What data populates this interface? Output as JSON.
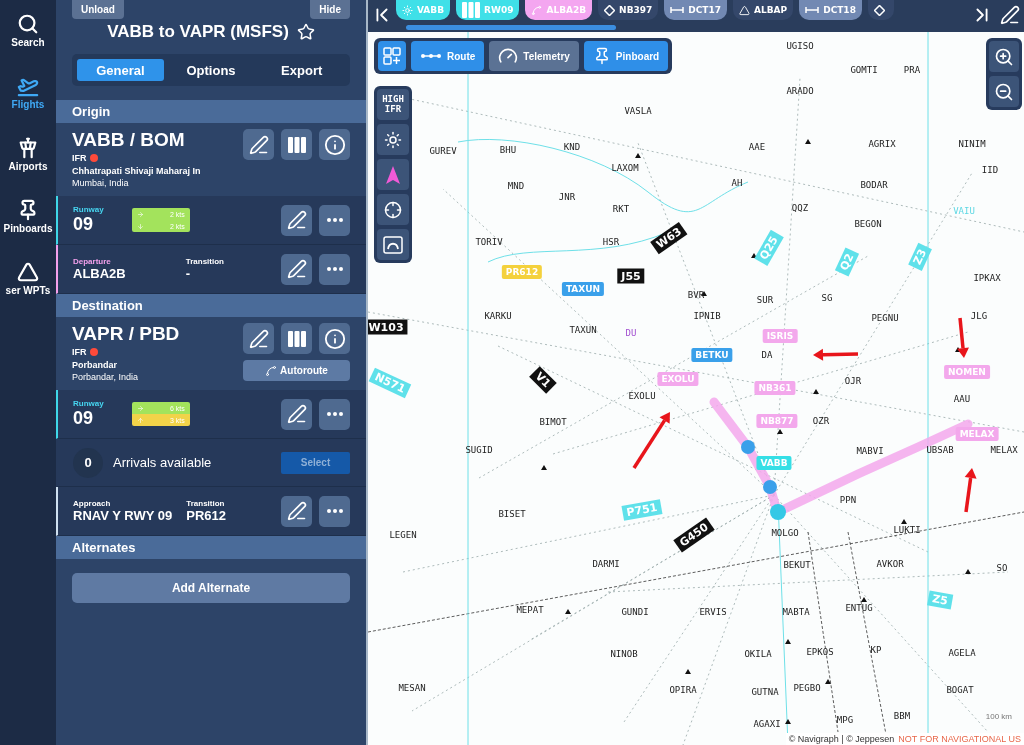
{
  "nav": [
    {
      "label": "Search",
      "selected": false
    },
    {
      "label": "Flights",
      "selected": true
    },
    {
      "label": "Airports",
      "selected": false
    },
    {
      "label": "Pinboards",
      "selected": false
    },
    {
      "label": "ser WPTs",
      "selected": false
    }
  ],
  "flight": {
    "unload": "Unload",
    "hide": "Hide",
    "title": "VABB to VAPR (MSFS)",
    "favorite": false,
    "tabs": [
      {
        "label": "General",
        "selected": true
      },
      {
        "label": "Options",
        "selected": false
      },
      {
        "label": "Export",
        "selected": false
      }
    ]
  },
  "origin": {
    "heading": "Origin",
    "code": "VABB / BOM",
    "rules": "IFR",
    "name": "Chhatrapati Shivaji Maharaj In",
    "city": "Mumbai, India",
    "runway": {
      "label": "Runway",
      "value": "09",
      "wind": [
        {
          "text": "2 kts",
          "kind": "crosswind",
          "color": "#a3e35c"
        },
        {
          "text": "2 kts",
          "kind": "tailwind",
          "color": "#a3e35c"
        }
      ]
    },
    "departure": {
      "label": "Departure",
      "value": "ALBA2B",
      "transition_label": "Transition",
      "transition": "-"
    }
  },
  "destination": {
    "heading": "Destination",
    "code": "VAPR / PBD",
    "rules": "IFR",
    "name": "Porbandar",
    "city": "Porbandar, India",
    "autoroute": "Autoroute",
    "runway": {
      "label": "Runway",
      "value": "09",
      "wind": [
        {
          "text": "6 kts",
          "kind": "crosswind",
          "color": "#a3e35c"
        },
        {
          "text": "3 kts",
          "kind": "headwind",
          "color": "#f2d349"
        }
      ]
    },
    "arrivals": {
      "count": "0",
      "label": "Arrivals available",
      "button": "Select"
    },
    "approach": {
      "label": "Approach",
      "value": "RNAV Y RWY 09",
      "transition_label": "Transition",
      "transition": "PR612"
    }
  },
  "alternates": {
    "heading": "Alternates",
    "button": "Add Alternate"
  },
  "route_bar": {
    "chips": [
      {
        "label": "VABB",
        "kind": "airport"
      },
      {
        "label": "RW09",
        "kind": "runway"
      },
      {
        "label": "ALBA2B",
        "kind": "procedure"
      },
      {
        "label": "NB397",
        "kind": "fix"
      },
      {
        "label": "DCT17",
        "kind": "direct"
      },
      {
        "label": "ALBAP",
        "kind": "user"
      },
      {
        "label": "DCT18",
        "kind": "direct"
      },
      {
        "kind": "fix"
      }
    ]
  },
  "map_toolbar": {
    "buttons": [
      {
        "label": "Route",
        "active": true
      },
      {
        "label": "Telemetry",
        "active": false
      },
      {
        "label": "Pinboard",
        "active": true
      }
    ]
  },
  "layers": {
    "level_label": "HIGH",
    "rules_label": "IFR"
  },
  "map": {
    "fixes": [
      {
        "label": "UGISO",
        "kind": "fix"
      },
      {
        "label": "GOMTI",
        "kind": "fix"
      },
      {
        "label": "PRA",
        "kind": "fix"
      },
      {
        "label": "ARADO",
        "kind": "fix"
      },
      {
        "label": "VASLA",
        "kind": "fix"
      },
      {
        "label": "GUREV",
        "kind": "fix"
      },
      {
        "label": "BHU",
        "kind": "fix"
      },
      {
        "label": "KND",
        "kind": "fix"
      },
      {
        "label": "AAE",
        "kind": "fix"
      },
      {
        "label": "AGRIX",
        "kind": "fix"
      },
      {
        "label": "NINIM",
        "kind": "fix"
      },
      {
        "label": "LAXOM",
        "kind": "fix"
      },
      {
        "label": "IID",
        "kind": "fix"
      },
      {
        "label": "MND",
        "kind": "fix"
      },
      {
        "label": "AH",
        "kind": "fix"
      },
      {
        "label": "BODAR",
        "kind": "fix"
      },
      {
        "label": "JNR",
        "kind": "fix"
      },
      {
        "label": "RKT",
        "kind": "fix"
      },
      {
        "label": "QQZ",
        "kind": "fix"
      },
      {
        "label": "VAIU",
        "kind": "fir"
      },
      {
        "label": "BEGON",
        "kind": "fix"
      },
      {
        "label": "TORIV",
        "kind": "fix"
      },
      {
        "label": "HSR",
        "kind": "fix"
      },
      {
        "label": "IPKAX",
        "kind": "fix"
      },
      {
        "label": "BVR",
        "kind": "fix"
      },
      {
        "label": "SUR",
        "kind": "fix"
      },
      {
        "label": "SG",
        "kind": "fix"
      },
      {
        "label": "KARKU",
        "kind": "fix"
      },
      {
        "label": "IPNIB",
        "kind": "fix"
      },
      {
        "label": "PEGNU",
        "kind": "fix"
      },
      {
        "label": "JLG",
        "kind": "fix"
      },
      {
        "label": "TAXUN",
        "kind": "fix"
      },
      {
        "label": "DU",
        "kind": "restricted"
      },
      {
        "label": "DA",
        "kind": "fix"
      },
      {
        "label": "OJR",
        "kind": "fix"
      },
      {
        "label": "EXOLU",
        "kind": "fix"
      },
      {
        "label": "AAU",
        "kind": "fix"
      },
      {
        "label": "BIMOT",
        "kind": "fix"
      },
      {
        "label": "OZR",
        "kind": "fix"
      },
      {
        "label": "SUGID",
        "kind": "fix"
      },
      {
        "label": "MABVI",
        "kind": "fix"
      },
      {
        "label": "UBSAB",
        "kind": "fix"
      },
      {
        "label": "MELAX",
        "kind": "fix"
      },
      {
        "label": "PPN",
        "kind": "fix"
      },
      {
        "label": "BISET",
        "kind": "fix"
      },
      {
        "label": "LEGEN",
        "kind": "fix"
      },
      {
        "label": "MOLGO",
        "kind": "fix"
      },
      {
        "label": "LUKTI",
        "kind": "fix"
      },
      {
        "label": "DARMI",
        "kind": "fix"
      },
      {
        "label": "BEKUT",
        "kind": "fix"
      },
      {
        "label": "AVKOR",
        "kind": "fix"
      },
      {
        "label": "SO",
        "kind": "fix"
      },
      {
        "label": "MEPAT",
        "kind": "fix"
      },
      {
        "label": "GUNDI",
        "kind": "fix"
      },
      {
        "label": "ERVIS",
        "kind": "fix"
      },
      {
        "label": "MABTA",
        "kind": "fix"
      },
      {
        "label": "ENTUG",
        "kind": "fix"
      },
      {
        "label": "NINOB",
        "kind": "fix"
      },
      {
        "label": "OKILA",
        "kind": "fix"
      },
      {
        "label": "EPKOS",
        "kind": "fix"
      },
      {
        "label": "KP",
        "kind": "fix"
      },
      {
        "label": "AGELA",
        "kind": "fix"
      },
      {
        "label": "MESAN",
        "kind": "fix"
      },
      {
        "label": "OPIRA",
        "kind": "fix"
      },
      {
        "label": "GUTNA",
        "kind": "fix"
      },
      {
        "label": "PEGBO",
        "kind": "fix"
      },
      {
        "label": "BOGAT",
        "kind": "fix"
      },
      {
        "label": "AGAXI",
        "kind": "fix"
      },
      {
        "label": "MPG",
        "kind": "fix"
      },
      {
        "label": "BBM",
        "kind": "fix"
      }
    ],
    "waypoints": [
      {
        "label": "PR612",
        "kind": "transition"
      },
      {
        "label": "TAXUN",
        "kind": "enroute"
      },
      {
        "label": "BETKU",
        "kind": "enroute"
      },
      {
        "label": "EXOLU",
        "kind": "highlight"
      },
      {
        "label": "ISRIS",
        "kind": "highlight"
      },
      {
        "label": "NB361",
        "kind": "highlight"
      },
      {
        "label": "NB877",
        "kind": "highlight"
      },
      {
        "label": "NOMEN",
        "kind": "highlight"
      },
      {
        "label": "MELAX",
        "kind": "highlight"
      },
      {
        "label": "VABB",
        "kind": "airport"
      }
    ],
    "airways": [
      {
        "label": "W63",
        "kind": "low"
      },
      {
        "label": "J55",
        "kind": "low"
      },
      {
        "label": "V1",
        "kind": "low"
      },
      {
        "label": "W103",
        "kind": "low"
      },
      {
        "label": "G450",
        "kind": "low"
      },
      {
        "label": "Q25",
        "kind": "high"
      },
      {
        "label": "Q2",
        "kind": "high"
      },
      {
        "label": "Z3",
        "kind": "high"
      },
      {
        "label": "N571",
        "kind": "high"
      },
      {
        "label": "P751",
        "kind": "high"
      },
      {
        "label": "Z5",
        "kind": "high"
      }
    ],
    "scale": "100 km",
    "attribution": "© Navigraph | © Jeppesen",
    "disclaimer": "NOT FOR NAVIGATIONAL US"
  }
}
